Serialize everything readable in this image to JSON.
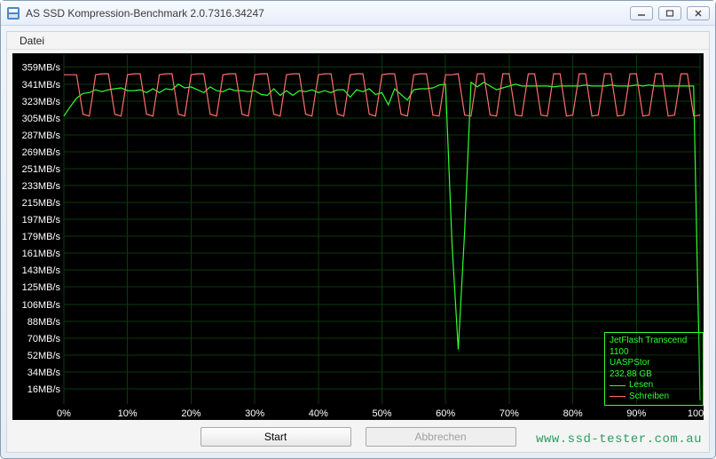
{
  "window": {
    "title": "AS SSD Kompression-Benchmark 2.0.7316.34247"
  },
  "menu": {
    "file": "Datei"
  },
  "buttons": {
    "start": "Start",
    "cancel": "Abbrechen"
  },
  "legend": {
    "device": "JetFlash Transcend",
    "model": "1100",
    "driver": "UASPStor",
    "capacity": "232,88 GB",
    "read": "Lesen",
    "write": "Schreiben"
  },
  "watermark": "www.ssd-tester.com.au",
  "chart_data": {
    "type": "line",
    "xlabel": "",
    "ylabel": "",
    "ylim": [
      0,
      372
    ],
    "xlim": [
      0,
      100
    ],
    "x_ticks": [
      "0%",
      "10%",
      "20%",
      "30%",
      "40%",
      "50%",
      "60%",
      "70%",
      "80%",
      "90%",
      "100%"
    ],
    "y_ticks": [
      "16MB/s",
      "34MB/s",
      "52MB/s",
      "70MB/s",
      "88MB/s",
      "106MB/s",
      "125MB/s",
      "143MB/s",
      "161MB/s",
      "179MB/s",
      "197MB/s",
      "215MB/s",
      "233MB/s",
      "251MB/s",
      "269MB/s",
      "287MB/s",
      "305MB/s",
      "323MB/s",
      "341MB/s",
      "359MB/s"
    ],
    "y_tick_values": [
      16,
      34,
      52,
      70,
      88,
      106,
      125,
      143,
      161,
      179,
      197,
      215,
      233,
      251,
      269,
      287,
      305,
      323,
      341,
      359
    ],
    "series": [
      {
        "name": "Lesen",
        "color": "#2eff2e",
        "x": [
          0,
          1,
          2,
          3,
          4,
          5,
          6,
          7,
          8,
          9,
          10,
          11,
          12,
          13,
          14,
          15,
          16,
          17,
          18,
          19,
          20,
          21,
          22,
          23,
          24,
          25,
          26,
          27,
          28,
          29,
          30,
          31,
          32,
          33,
          34,
          35,
          36,
          37,
          38,
          39,
          40,
          41,
          42,
          43,
          44,
          45,
          46,
          47,
          48,
          49,
          50,
          51,
          52,
          53,
          54,
          55,
          56,
          57,
          58,
          59,
          60,
          61,
          62,
          63,
          64,
          65,
          66,
          67,
          68,
          69,
          70,
          71,
          72,
          73,
          74,
          75,
          76,
          77,
          78,
          79,
          80,
          81,
          82,
          83,
          84,
          85,
          86,
          87,
          88,
          89,
          90,
          91,
          92,
          93,
          94,
          95,
          96,
          97,
          98,
          99,
          100
        ],
        "values": [
          307,
          317,
          326,
          331,
          332,
          335,
          333,
          335,
          336,
          337,
          334,
          334,
          335,
          332,
          336,
          332,
          336,
          335,
          341,
          337,
          338,
          335,
          332,
          338,
          334,
          333,
          336,
          334,
          334,
          333,
          334,
          330,
          329,
          336,
          329,
          334,
          329,
          334,
          333,
          335,
          332,
          334,
          332,
          335,
          335,
          327,
          335,
          333,
          336,
          330,
          332,
          319,
          336,
          330,
          324,
          335,
          336,
          336,
          337,
          340,
          341,
          172,
          58,
          184,
          343,
          338,
          343,
          339,
          335,
          337,
          339,
          341,
          339,
          339,
          339,
          339,
          339,
          338,
          339,
          339,
          339,
          339,
          340,
          339,
          339,
          339,
          340,
          339,
          339,
          339,
          340,
          339,
          340,
          339,
          339,
          339,
          339,
          339,
          339,
          339,
          4
        ]
      },
      {
        "name": "Schreiben",
        "color": "#ff6e6e",
        "x": [
          0,
          1,
          2,
          3,
          4,
          5,
          6,
          7,
          8,
          9,
          10,
          11,
          12,
          13,
          14,
          15,
          16,
          17,
          18,
          19,
          20,
          21,
          22,
          23,
          24,
          25,
          26,
          27,
          28,
          29,
          30,
          31,
          32,
          33,
          34,
          35,
          36,
          37,
          38,
          39,
          40,
          41,
          42,
          43,
          44,
          45,
          46,
          47,
          48,
          49,
          50,
          51,
          52,
          53,
          54,
          55,
          56,
          57,
          58,
          59,
          60,
          61,
          62,
          63,
          64,
          65,
          66,
          67,
          68,
          69,
          70,
          71,
          72,
          73,
          74,
          75,
          76,
          77,
          78,
          79,
          80,
          81,
          82,
          83,
          84,
          85,
          86,
          87,
          88,
          89,
          90,
          91,
          92,
          93,
          94,
          95,
          96,
          97,
          98,
          99,
          100
        ],
        "values": [
          351,
          351,
          351,
          309,
          307,
          351,
          352,
          352,
          309,
          307,
          351,
          352,
          352,
          309,
          307,
          351,
          352,
          352,
          309,
          307,
          351,
          352,
          352,
          309,
          307,
          351,
          352,
          352,
          309,
          307,
          351,
          352,
          352,
          309,
          307,
          351,
          352,
          352,
          309,
          307,
          351,
          352,
          352,
          309,
          307,
          351,
          352,
          352,
          309,
          307,
          351,
          352,
          352,
          309,
          307,
          351,
          352,
          352,
          308,
          307,
          351,
          351,
          352,
          308,
          307,
          352,
          352,
          308,
          307,
          352,
          352,
          308,
          307,
          352,
          352,
          308,
          307,
          352,
          352,
          307,
          308,
          352,
          352,
          307,
          308,
          352,
          352,
          307,
          308,
          352,
          352,
          307,
          308,
          352,
          352,
          307,
          308,
          352,
          352,
          307,
          308
        ]
      }
    ]
  }
}
